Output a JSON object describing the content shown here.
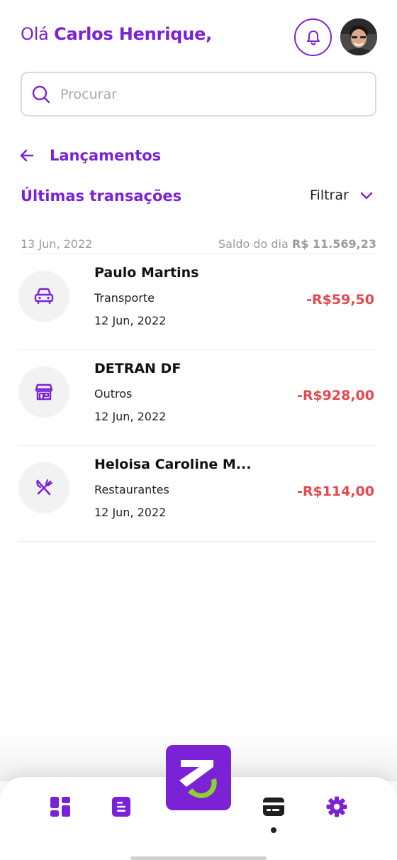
{
  "header": {
    "greeting_prefix": "Olá",
    "user_name": "Carlos Henrique,",
    "bell_icon": "bell-icon",
    "avatar": "user-avatar"
  },
  "search": {
    "placeholder": "Procurar",
    "value": "",
    "icon": "search-icon"
  },
  "section": {
    "back_icon": "arrow-left-icon",
    "title": "Lançamentos",
    "subtitle": "Últimas transações",
    "filter_label": "Filtrar",
    "filter_icon": "chevron-down-icon"
  },
  "day": {
    "date": "13 Jun, 2022",
    "balance_label": "Saldo do dia",
    "balance_value": "R$ 11.569,23"
  },
  "transactions": [
    {
      "name": "Paulo Martins",
      "category": "Transporte",
      "date": "12 Jun, 2022",
      "amount": "-R$59,50",
      "icon": "car-icon"
    },
    {
      "name": "DETRAN DF",
      "category": "Outros",
      "date": "12 Jun, 2022",
      "amount": "-R$928,00",
      "icon": "store-icon"
    },
    {
      "name": "Heloisa Caroline M...",
      "category": "Restaurantes",
      "date": "12 Jun, 2022",
      "amount": "-R$114,00",
      "icon": "fork-knife-icon"
    }
  ],
  "bottom_nav": {
    "items": [
      "dashboard-icon",
      "document-icon",
      "app-logo",
      "card-icon",
      "settings-icon"
    ],
    "active_index": 3
  },
  "colors": {
    "primary": "#7c22d6",
    "negative": "#e5484d",
    "accent_green": "#8bd22c",
    "muted": "#9b9b9b"
  }
}
